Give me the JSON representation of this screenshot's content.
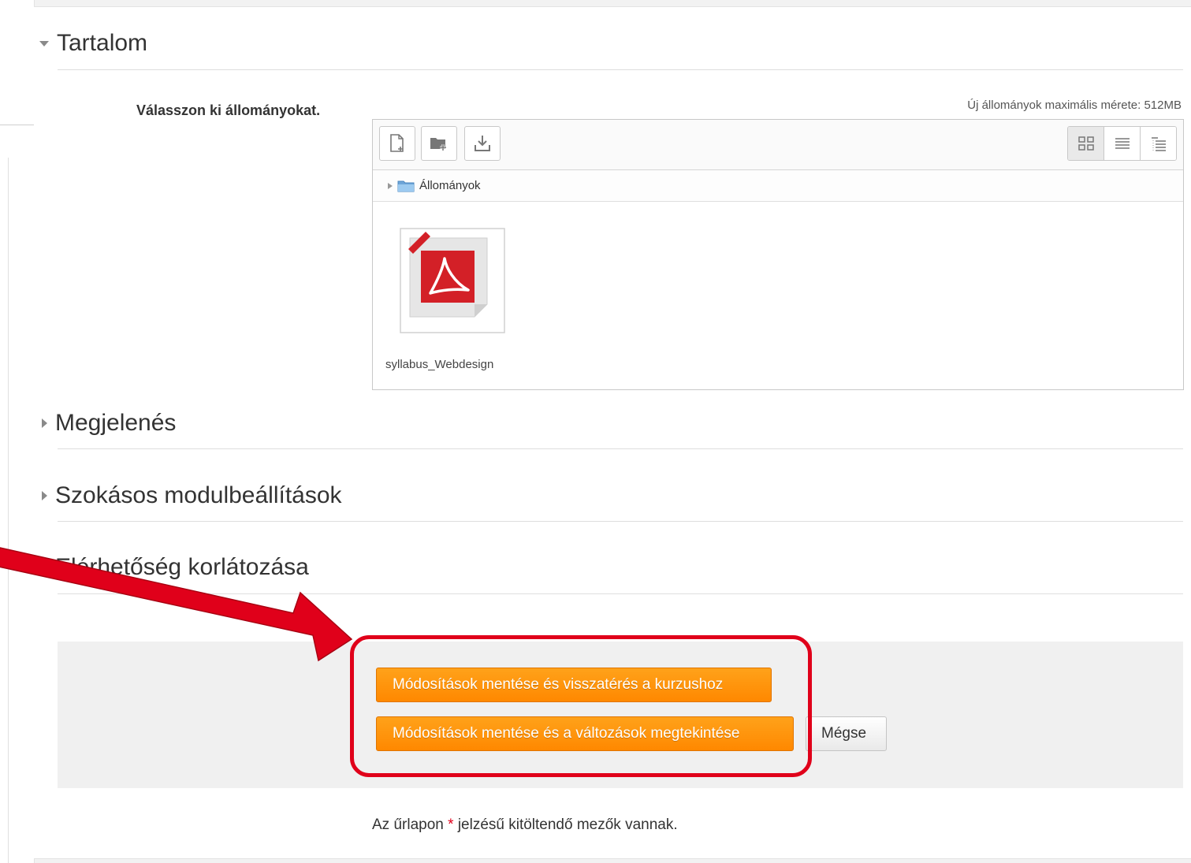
{
  "sections": {
    "content_title": "Tartalom",
    "appearance_title": "Megjelenés",
    "common_settings_title": "Szokásos modulbeállítások",
    "restrict_access_title": "Elérhetőség korlátozása"
  },
  "file_picker": {
    "label": "Válasszon ki állományokat.",
    "max_size_text": "Új állományok maximális mérete: 512MB",
    "path_root": "Állományok",
    "files": [
      {
        "name": "syllabus_Webdesign",
        "icon": "pdf-file-icon"
      }
    ],
    "toolbar_icons": [
      "add-file-icon",
      "create-folder-icon",
      "download-icon"
    ],
    "view_icons": [
      "grid-view-icon",
      "list-view-icon",
      "tree-view-icon"
    ]
  },
  "actions": {
    "save_return": "Módosítások mentése és visszatérés a kurzushoz",
    "save_display": "Módosítások mentése és a változások megtekintése",
    "cancel": "Mégse"
  },
  "required_note": {
    "prefix": "Az űrlapon",
    "star": "*",
    "suffix": "jelzésű kitöltendő mezők vannak."
  },
  "colors": {
    "primary_button": "#ff9410",
    "annotation_red": "#e0001a",
    "pdf_red": "#d32027"
  }
}
